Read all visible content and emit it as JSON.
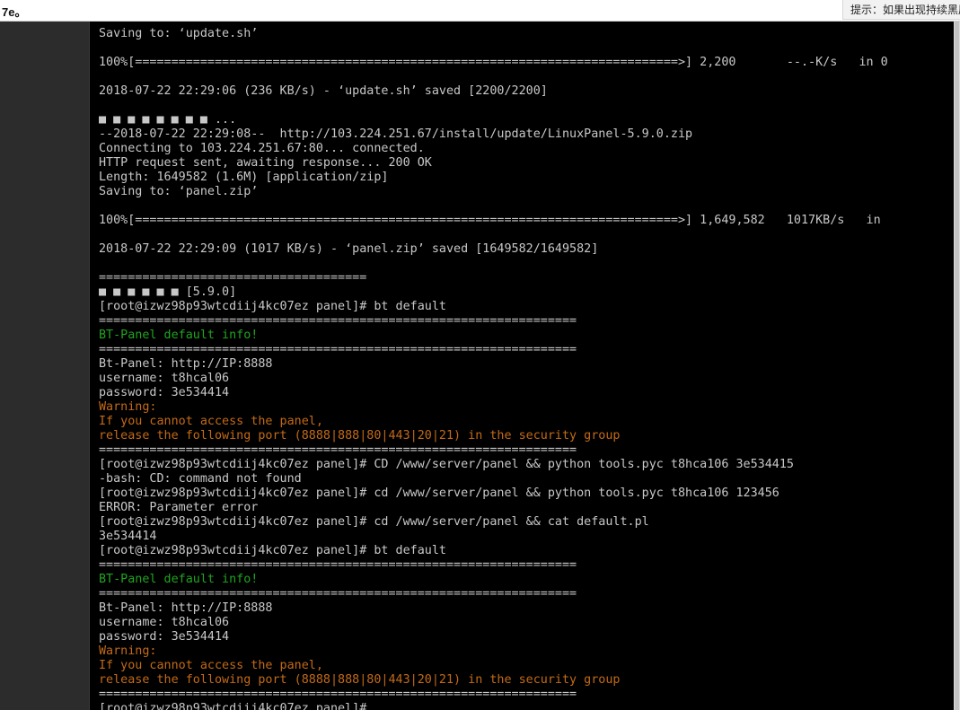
{
  "topbar": {
    "left_text": "7e。",
    "hint_text": "提示：如果出现持续黑屏"
  },
  "colors": {
    "terminal_bg": "#000000",
    "text_default": "#c8c8c8",
    "text_green": "#1fa51f",
    "text_orange": "#c36a16"
  },
  "terminal": {
    "lines": [
      {
        "text": "Saving to: ‘update.sh’",
        "style": "default"
      },
      {
        "text": "",
        "style": "default"
      },
      {
        "text": "100%[===========================================================================>] 2,200       --.-K/s   in 0",
        "style": "default"
      },
      {
        "text": "",
        "style": "default"
      },
      {
        "text": "2018-07-22 22:29:06 (236 KB/s) - ‘update.sh’ saved [2200/2200]",
        "style": "default"
      },
      {
        "text": "",
        "style": "default"
      },
      {
        "text": "■ ■ ■ ■ ■ ■ ■ ■ ...",
        "style": "default"
      },
      {
        "text": "--2018-07-22 22:29:08--  http://103.224.251.67/install/update/LinuxPanel-5.9.0.zip",
        "style": "default"
      },
      {
        "text": "Connecting to 103.224.251.67:80... connected.",
        "style": "default"
      },
      {
        "text": "HTTP request sent, awaiting response... 200 OK",
        "style": "default"
      },
      {
        "text": "Length: 1649582 (1.6M) [application/zip]",
        "style": "default"
      },
      {
        "text": "Saving to: ‘panel.zip’",
        "style": "default"
      },
      {
        "text": "",
        "style": "default"
      },
      {
        "text": "100%[===========================================================================>] 1,649,582   1017KB/s   in",
        "style": "default"
      },
      {
        "text": "",
        "style": "default"
      },
      {
        "text": "2018-07-22 22:29:09 (1017 KB/s) - ‘panel.zip’ saved [1649582/1649582]",
        "style": "default"
      },
      {
        "text": "",
        "style": "default"
      },
      {
        "text": "=====================================",
        "style": "default"
      },
      {
        "text": "■ ■ ■ ■ ■ ■ [5.9.0]",
        "style": "default"
      },
      {
        "text": "[root@izwz98p93wtcdiij4kc07ez panel]# bt default",
        "style": "default"
      },
      {
        "text": "==================================================================",
        "style": "default"
      },
      {
        "text": "BT-Panel default info!",
        "style": "green"
      },
      {
        "text": "==================================================================",
        "style": "default"
      },
      {
        "text": "Bt-Panel: http://IP:8888",
        "style": "default"
      },
      {
        "text": "username: t8hcal06",
        "style": "default"
      },
      {
        "text": "password: 3e534414",
        "style": "default"
      },
      {
        "text": "Warning:",
        "style": "orange"
      },
      {
        "text": "If you cannot access the panel,",
        "style": "orange"
      },
      {
        "text": "release the following port (8888|888|80|443|20|21) in the security group",
        "style": "orange"
      },
      {
        "text": "==================================================================",
        "style": "default"
      },
      {
        "text": "[root@izwz98p93wtcdiij4kc07ez panel]# CD /www/server/panel && python tools.pyc t8hca106 3e534415",
        "style": "default"
      },
      {
        "text": "-bash: CD: command not found",
        "style": "default"
      },
      {
        "text": "[root@izwz98p93wtcdiij4kc07ez panel]# cd /www/server/panel && python tools.pyc t8hca106 123456",
        "style": "default"
      },
      {
        "text": "ERROR: Parameter error",
        "style": "default"
      },
      {
        "text": "[root@izwz98p93wtcdiij4kc07ez panel]# cd /www/server/panel && cat default.pl",
        "style": "default"
      },
      {
        "text": "3e534414",
        "style": "default"
      },
      {
        "text": "[root@izwz98p93wtcdiij4kc07ez panel]# bt default",
        "style": "default"
      },
      {
        "text": "==================================================================",
        "style": "default"
      },
      {
        "text": "BT-Panel default info!",
        "style": "green"
      },
      {
        "text": "==================================================================",
        "style": "default"
      },
      {
        "text": "Bt-Panel: http://IP:8888",
        "style": "default"
      },
      {
        "text": "username: t8hcal06",
        "style": "default"
      },
      {
        "text": "password: 3e534414",
        "style": "default"
      },
      {
        "text": "Warning:",
        "style": "orange"
      },
      {
        "text": "If you cannot access the panel,",
        "style": "orange"
      },
      {
        "text": "release the following port (8888|888|80|443|20|21) in the security group",
        "style": "orange"
      },
      {
        "text": "==================================================================",
        "style": "default"
      },
      {
        "text": "[root@izwz98p93wtcdiij4kc07ez panel]#",
        "style": "default"
      }
    ]
  }
}
